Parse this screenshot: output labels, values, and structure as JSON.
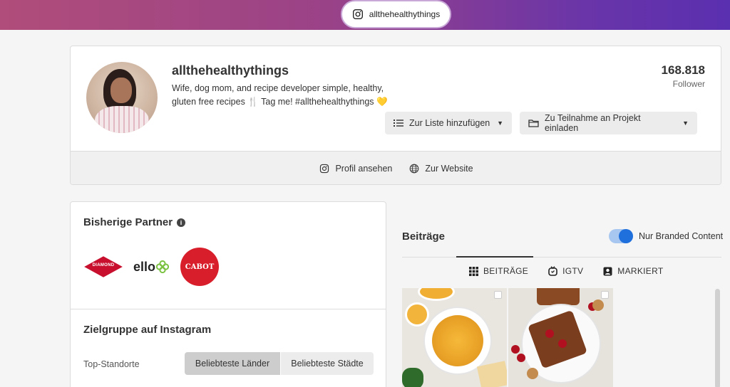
{
  "header": {
    "handle": "allthehealthythings",
    "icon": "instagram-icon"
  },
  "profile": {
    "name": "allthehealthythings",
    "bio": "Wife, dog mom, and recipe developer simple, healthy, gluten free recipes 🍴 Tag me! #allthehealthythings 💛",
    "followers_count": "168.818",
    "followers_label": "Follower",
    "add_to_list_label": "Zur Liste hinzufügen",
    "invite_project_label": "Zu Teilnahme an Projekt einladen",
    "view_profile_label": "Profil ansehen",
    "to_website_label": "Zur Website"
  },
  "partners": {
    "title": "Bisherige Partner",
    "logos": [
      {
        "name": "DIAMOND"
      },
      {
        "name": "ello"
      },
      {
        "name": "CABOT"
      }
    ]
  },
  "audience": {
    "title": "Zielgruppe auf Instagram",
    "top_locations_label": "Top-Standorte",
    "tab_countries": "Beliebteste Länder",
    "tab_cities": "Beliebteste Städte",
    "active_tab": "countries"
  },
  "posts": {
    "title": "Beiträge",
    "branded_toggle_label": "Nur Branded Content",
    "branded_toggle_on": true,
    "tabs": [
      {
        "label": "BEITRÄGE",
        "icon": "grid-icon",
        "active": true
      },
      {
        "label": "IGTV",
        "icon": "igtv-icon",
        "active": false
      },
      {
        "label": "MARKIERT",
        "icon": "tagged-icon",
        "active": false
      }
    ]
  },
  "colors": {
    "header_gradient_start": "#b04d7a",
    "header_gradient_end": "#5a2fb0",
    "toggle_accent": "#1f6fdd"
  }
}
